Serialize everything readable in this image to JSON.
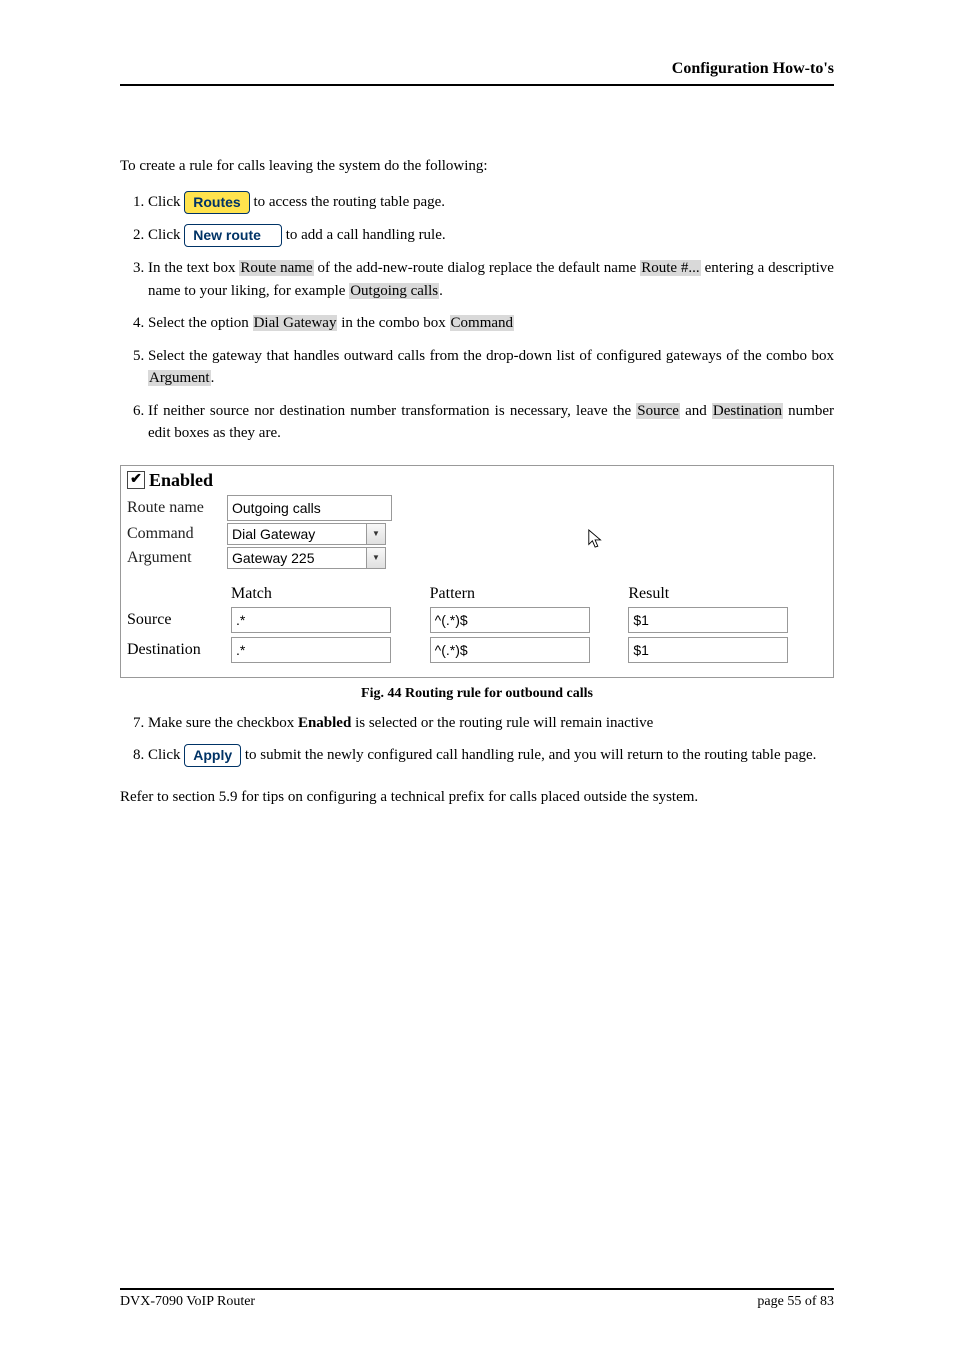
{
  "header": {
    "title": "Configuration How-to's"
  },
  "intro": "To create a rule for calls leaving the system do the following:",
  "buttons": {
    "routes": "Routes",
    "new_route": "New route",
    "apply": "Apply"
  },
  "steps": {
    "s1_a": "Click ",
    "s1_b": " to access the routing table page.",
    "s2_a": "Click ",
    "s2_b": " to add a call handling rule.",
    "s3_a": "In the text box ",
    "s3_route_name": "Route name",
    "s3_b": " of the add-new-route dialog replace the default name ",
    "s3_route_num": "Route #...",
    "s3_c": " entering a descriptive name to your liking, for example ",
    "s3_outgoing": "Outgoing calls",
    "s3_d": ".",
    "s4_a": "Select the option ",
    "s4_dial": "Dial Gateway",
    "s4_b": " in the combo box ",
    "s4_cmd": "Command",
    "s5_a": "Select the gateway that handles outward calls from the drop-down list of configured gateways of the combo box ",
    "s5_arg": "Argument",
    "s5_b": ".",
    "s6_a": "If neither source nor destination number transformation is necessary, leave the ",
    "s6_src": "Source",
    "s6_b": " and ",
    "s6_dest": "Destination",
    "s6_c": " number edit boxes as they are.",
    "s7_a": "Make sure the checkbox ",
    "s7_enabled": "Enabled",
    "s7_b": " is selected or the routing rule will remain inactive",
    "s8_a": "Click ",
    "s8_b": " to submit the newly configured call handling rule, and you will return to the routing table page."
  },
  "figure": {
    "enabled_label": "Enabled",
    "route_name_label": "Route name",
    "route_name_value": "Outgoing calls",
    "command_label": "Command",
    "command_value": "Dial Gateway",
    "argument_label": "Argument",
    "argument_value": "Gateway 225",
    "col_match": "Match",
    "col_pattern": "Pattern",
    "col_result": "Result",
    "row_source": "Source",
    "row_dest": "Destination",
    "src_match": ".*",
    "src_pattern": "^(.*)$",
    "src_result": "$1",
    "dest_match": ".*",
    "dest_pattern": "^(.*)$",
    "dest_result": "$1"
  },
  "caption": "Fig. 44 Routing rule for outbound calls",
  "closing": "Refer to section 5.9 for tips on configuring a technical prefix for calls placed outside the system.",
  "footer": {
    "left": "DVX-7090 VoIP Router",
    "right": "page 55 of 83"
  }
}
